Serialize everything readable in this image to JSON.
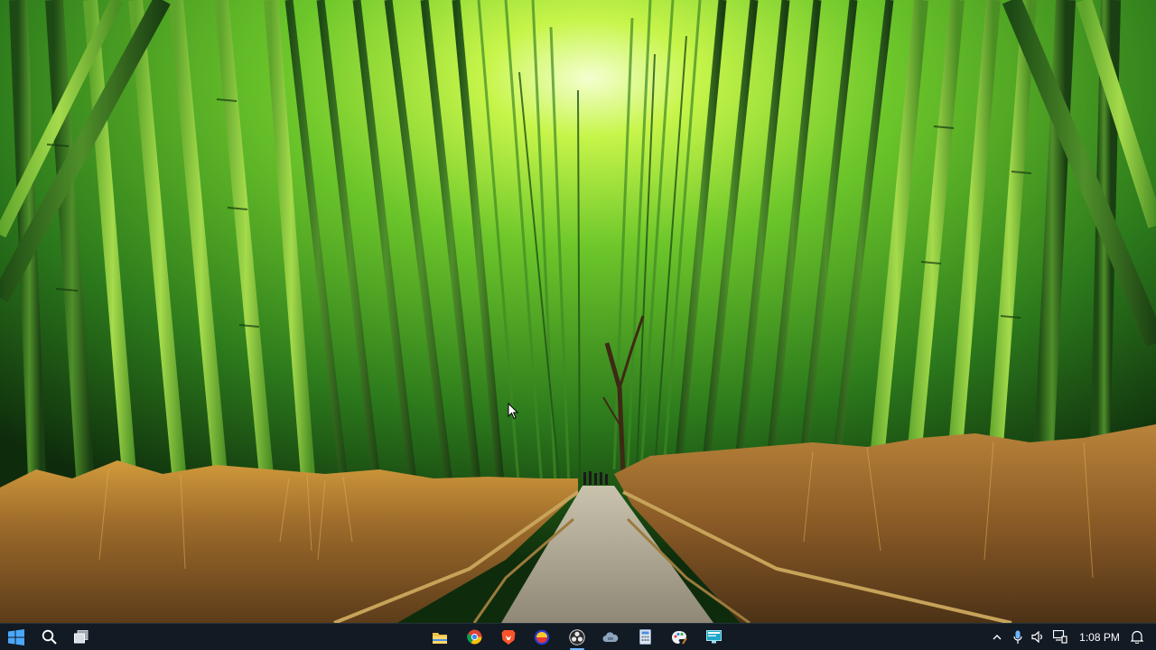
{
  "desktop": {
    "wallpaper": "bamboo-forest-path-wallpaper",
    "colors": {
      "bamboo_light": "#b8f23a",
      "bamboo_mid": "#5aa82a",
      "bamboo_dark": "#173d12",
      "grass": "#a9742c",
      "path": "#a7a08d"
    }
  },
  "taskbar": {
    "background": "#121a23",
    "left": [
      {
        "name": "start-button",
        "icon": "windows-logo-icon"
      },
      {
        "name": "search-button",
        "icon": "search-icon"
      },
      {
        "name": "task-view-button",
        "icon": "task-view-icon"
      }
    ],
    "pinned_apps": [
      {
        "name": "file-explorer",
        "icon": "folder-icon",
        "active": false
      },
      {
        "name": "chrome",
        "icon": "chrome-icon",
        "active": false
      },
      {
        "name": "brave",
        "icon": "brave-lion-icon",
        "active": false
      },
      {
        "name": "app-red-yellow",
        "icon": "circle-app-icon",
        "active": false
      },
      {
        "name": "obs-studio",
        "icon": "obs-icon",
        "active": true
      },
      {
        "name": "app-cloud",
        "icon": "cloud-app-icon",
        "active": false
      },
      {
        "name": "calculator",
        "icon": "calculator-icon",
        "active": false
      },
      {
        "name": "paint",
        "icon": "paint-palette-icon",
        "active": false
      },
      {
        "name": "app-monitor",
        "icon": "monitor-app-icon",
        "active": false
      }
    ],
    "tray": {
      "icons": [
        "chevron-up-icon",
        "microphone-icon",
        "speaker-icon",
        "network-icon"
      ],
      "clock": "1:08 PM",
      "notification_icon": "bell-icon"
    }
  }
}
